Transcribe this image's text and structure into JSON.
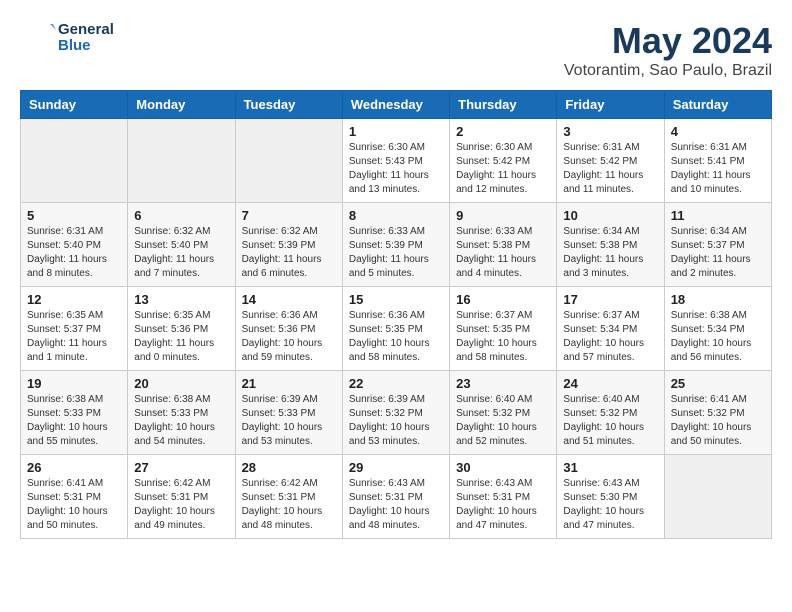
{
  "header": {
    "logo_line1": "General",
    "logo_line2": "Blue",
    "month": "May 2024",
    "location": "Votorantim, Sao Paulo, Brazil"
  },
  "weekdays": [
    "Sunday",
    "Monday",
    "Tuesday",
    "Wednesday",
    "Thursday",
    "Friday",
    "Saturday"
  ],
  "weeks": [
    [
      {
        "day": "",
        "info": ""
      },
      {
        "day": "",
        "info": ""
      },
      {
        "day": "",
        "info": ""
      },
      {
        "day": "1",
        "info": "Sunrise: 6:30 AM\nSunset: 5:43 PM\nDaylight: 11 hours\nand 13 minutes."
      },
      {
        "day": "2",
        "info": "Sunrise: 6:30 AM\nSunset: 5:42 PM\nDaylight: 11 hours\nand 12 minutes."
      },
      {
        "day": "3",
        "info": "Sunrise: 6:31 AM\nSunset: 5:42 PM\nDaylight: 11 hours\nand 11 minutes."
      },
      {
        "day": "4",
        "info": "Sunrise: 6:31 AM\nSunset: 5:41 PM\nDaylight: 11 hours\nand 10 minutes."
      }
    ],
    [
      {
        "day": "5",
        "info": "Sunrise: 6:31 AM\nSunset: 5:40 PM\nDaylight: 11 hours\nand 8 minutes."
      },
      {
        "day": "6",
        "info": "Sunrise: 6:32 AM\nSunset: 5:40 PM\nDaylight: 11 hours\nand 7 minutes."
      },
      {
        "day": "7",
        "info": "Sunrise: 6:32 AM\nSunset: 5:39 PM\nDaylight: 11 hours\nand 6 minutes."
      },
      {
        "day": "8",
        "info": "Sunrise: 6:33 AM\nSunset: 5:39 PM\nDaylight: 11 hours\nand 5 minutes."
      },
      {
        "day": "9",
        "info": "Sunrise: 6:33 AM\nSunset: 5:38 PM\nDaylight: 11 hours\nand 4 minutes."
      },
      {
        "day": "10",
        "info": "Sunrise: 6:34 AM\nSunset: 5:38 PM\nDaylight: 11 hours\nand 3 minutes."
      },
      {
        "day": "11",
        "info": "Sunrise: 6:34 AM\nSunset: 5:37 PM\nDaylight: 11 hours\nand 2 minutes."
      }
    ],
    [
      {
        "day": "12",
        "info": "Sunrise: 6:35 AM\nSunset: 5:37 PM\nDaylight: 11 hours\nand 1 minute."
      },
      {
        "day": "13",
        "info": "Sunrise: 6:35 AM\nSunset: 5:36 PM\nDaylight: 11 hours\nand 0 minutes."
      },
      {
        "day": "14",
        "info": "Sunrise: 6:36 AM\nSunset: 5:36 PM\nDaylight: 10 hours\nand 59 minutes."
      },
      {
        "day": "15",
        "info": "Sunrise: 6:36 AM\nSunset: 5:35 PM\nDaylight: 10 hours\nand 58 minutes."
      },
      {
        "day": "16",
        "info": "Sunrise: 6:37 AM\nSunset: 5:35 PM\nDaylight: 10 hours\nand 58 minutes."
      },
      {
        "day": "17",
        "info": "Sunrise: 6:37 AM\nSunset: 5:34 PM\nDaylight: 10 hours\nand 57 minutes."
      },
      {
        "day": "18",
        "info": "Sunrise: 6:38 AM\nSunset: 5:34 PM\nDaylight: 10 hours\nand 56 minutes."
      }
    ],
    [
      {
        "day": "19",
        "info": "Sunrise: 6:38 AM\nSunset: 5:33 PM\nDaylight: 10 hours\nand 55 minutes."
      },
      {
        "day": "20",
        "info": "Sunrise: 6:38 AM\nSunset: 5:33 PM\nDaylight: 10 hours\nand 54 minutes."
      },
      {
        "day": "21",
        "info": "Sunrise: 6:39 AM\nSunset: 5:33 PM\nDaylight: 10 hours\nand 53 minutes."
      },
      {
        "day": "22",
        "info": "Sunrise: 6:39 AM\nSunset: 5:32 PM\nDaylight: 10 hours\nand 53 minutes."
      },
      {
        "day": "23",
        "info": "Sunrise: 6:40 AM\nSunset: 5:32 PM\nDaylight: 10 hours\nand 52 minutes."
      },
      {
        "day": "24",
        "info": "Sunrise: 6:40 AM\nSunset: 5:32 PM\nDaylight: 10 hours\nand 51 minutes."
      },
      {
        "day": "25",
        "info": "Sunrise: 6:41 AM\nSunset: 5:32 PM\nDaylight: 10 hours\nand 50 minutes."
      }
    ],
    [
      {
        "day": "26",
        "info": "Sunrise: 6:41 AM\nSunset: 5:31 PM\nDaylight: 10 hours\nand 50 minutes."
      },
      {
        "day": "27",
        "info": "Sunrise: 6:42 AM\nSunset: 5:31 PM\nDaylight: 10 hours\nand 49 minutes."
      },
      {
        "day": "28",
        "info": "Sunrise: 6:42 AM\nSunset: 5:31 PM\nDaylight: 10 hours\nand 48 minutes."
      },
      {
        "day": "29",
        "info": "Sunrise: 6:43 AM\nSunset: 5:31 PM\nDaylight: 10 hours\nand 48 minutes."
      },
      {
        "day": "30",
        "info": "Sunrise: 6:43 AM\nSunset: 5:31 PM\nDaylight: 10 hours\nand 47 minutes."
      },
      {
        "day": "31",
        "info": "Sunrise: 6:43 AM\nSunset: 5:30 PM\nDaylight: 10 hours\nand 47 minutes."
      },
      {
        "day": "",
        "info": ""
      }
    ]
  ]
}
